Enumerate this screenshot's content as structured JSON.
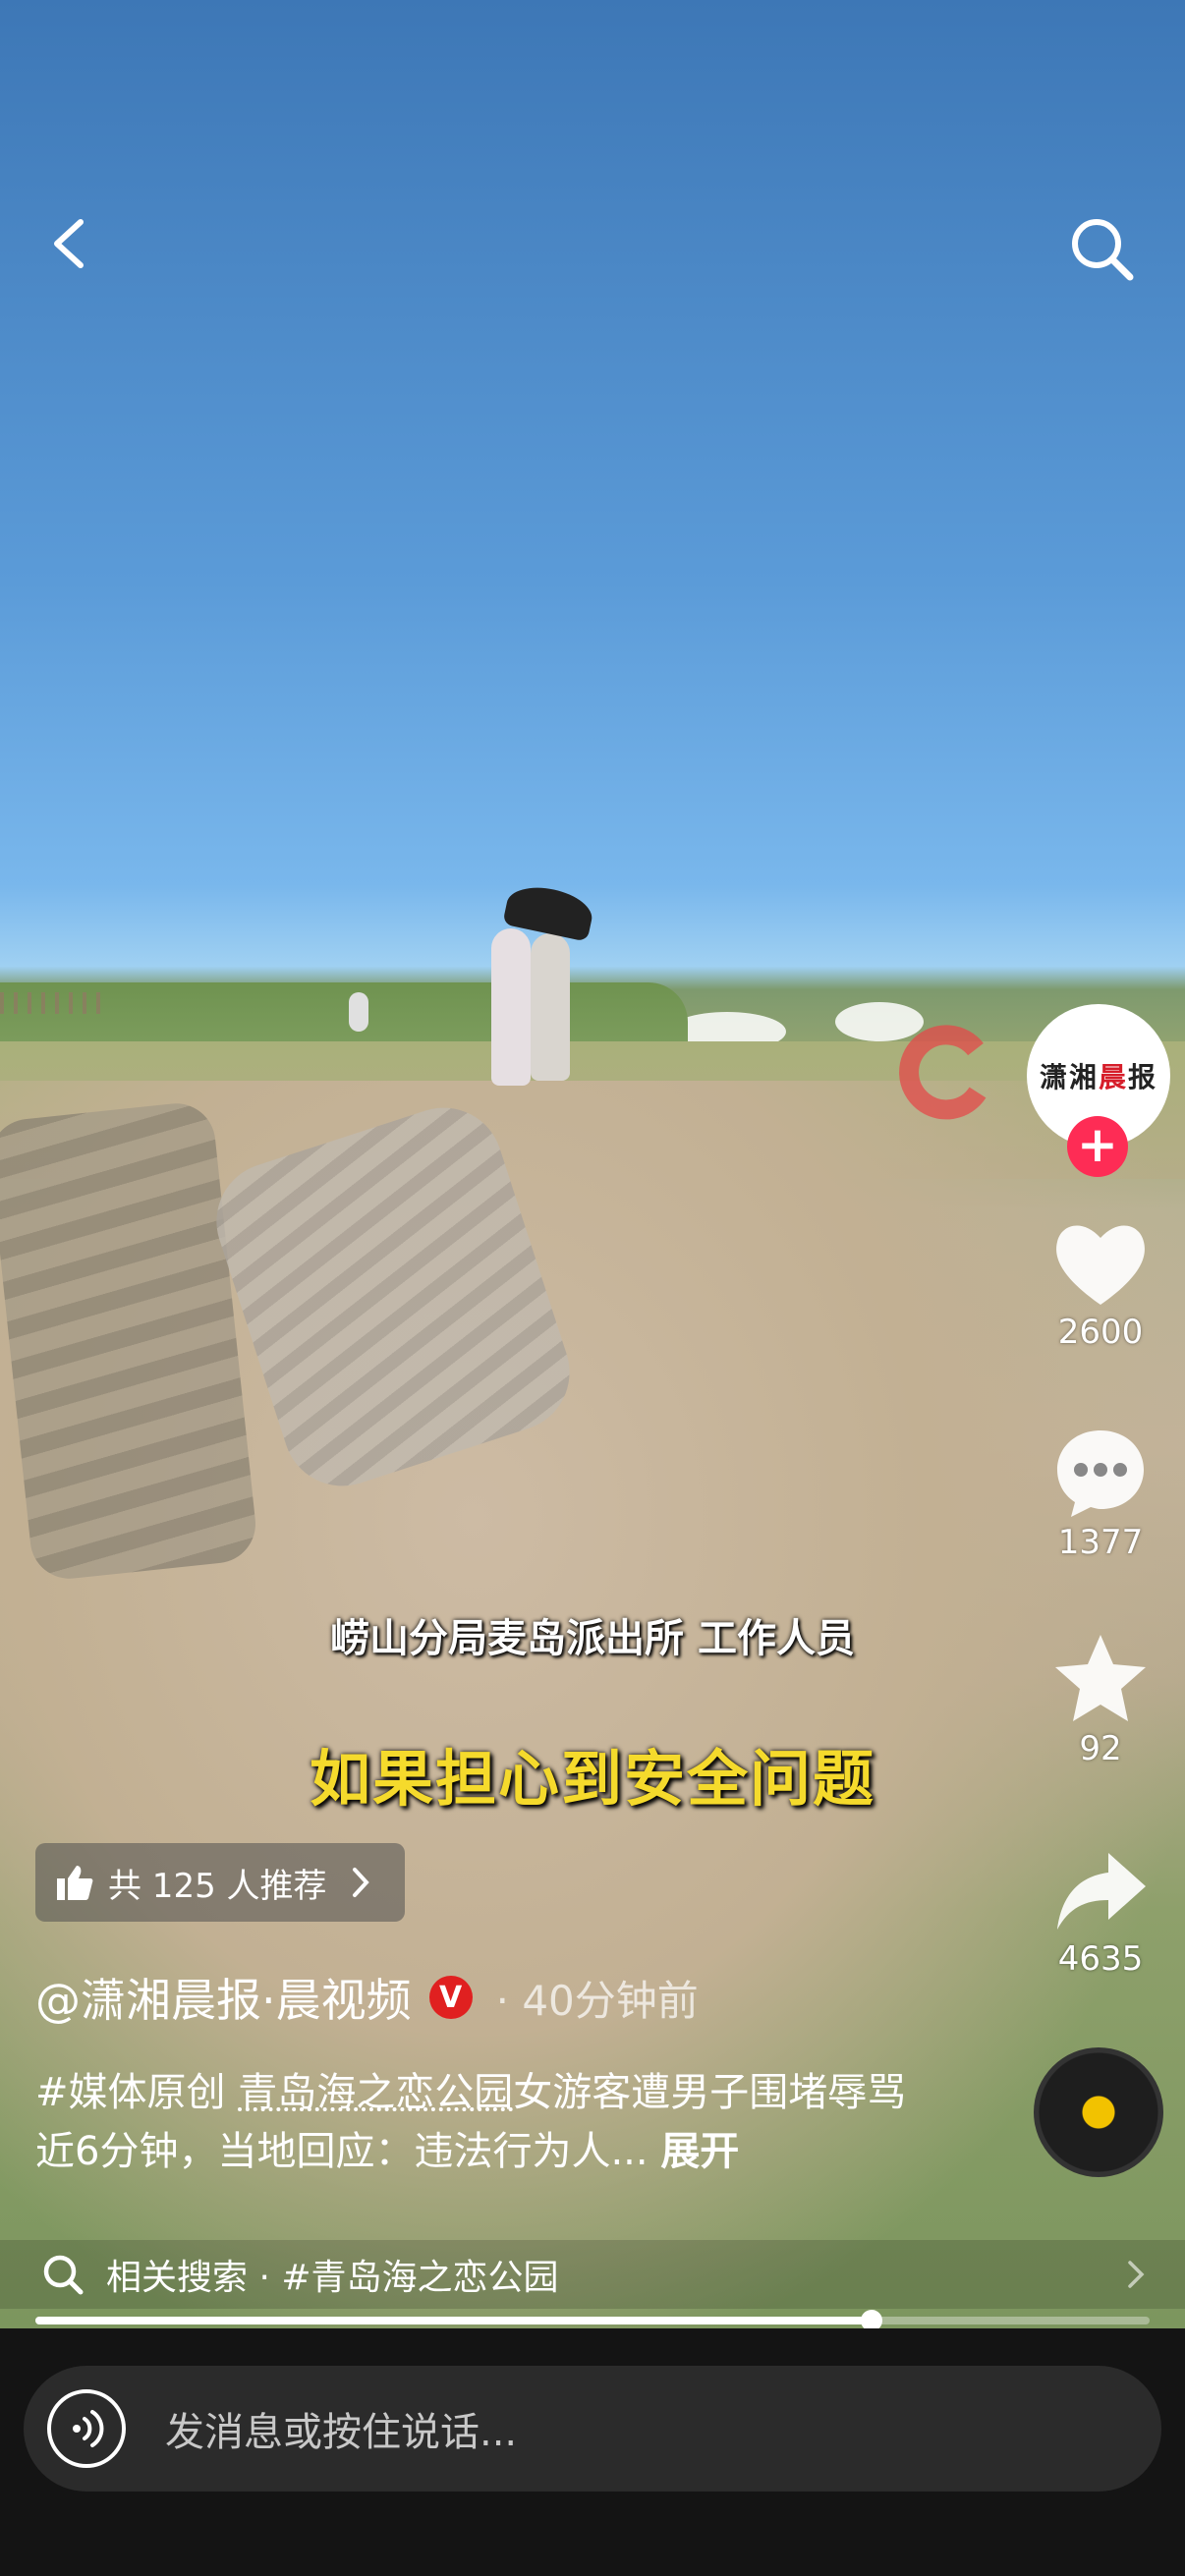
{
  "video": {
    "subtitle_speaker": "崂山分局麦岛派出所 工作人员",
    "subtitle_main": "如果担心到安全问题"
  },
  "topbar": {
    "back_icon": "chevron-left-icon",
    "search_icon": "search-icon"
  },
  "sidebar": {
    "avatar_text_black": "潇湘",
    "avatar_text_red": "晨",
    "avatar_text_black2": "报",
    "follow": "+",
    "likes": "2600",
    "comments": "1377",
    "favorites": "92",
    "shares": "4635"
  },
  "recommend": {
    "label": "共 125 人推荐",
    "icon": "thumbs-up-icon"
  },
  "author": {
    "name": "@潇湘晨报·晨视频",
    "verified": "V",
    "time": "· 40分钟前"
  },
  "description": {
    "hashtag": "#媒体原创 ",
    "highlight": "青岛海之恋公园",
    "text": "女游客遭男子围堵辱骂近6分钟，当地回应：违法行为人...",
    "expand": "展开"
  },
  "related": {
    "label": "相关搜索 · #青岛海之恋公园"
  },
  "progress": {
    "fraction": 0.75
  },
  "message": {
    "placeholder": "发消息或按住说话..."
  },
  "colors": {
    "follow": "#fe2c55",
    "subtitle_main": "#f5da2c",
    "verified": "#e02020"
  }
}
